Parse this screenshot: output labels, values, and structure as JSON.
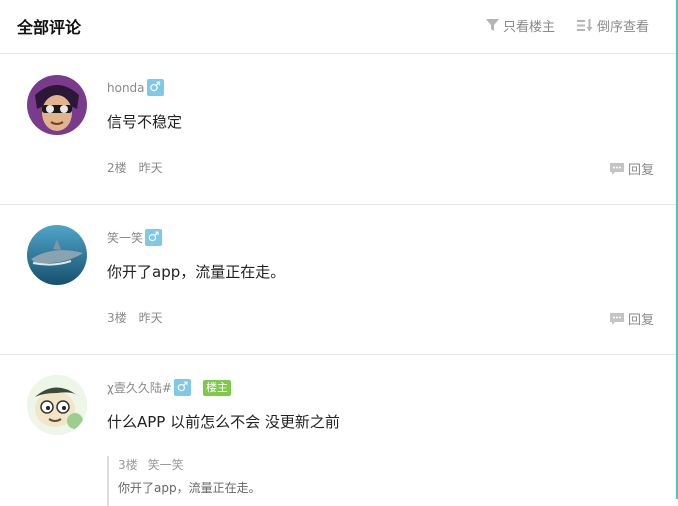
{
  "header": {
    "title": "全部评论",
    "only_op": "只看楼主",
    "reverse": "倒序查看"
  },
  "comments": [
    {
      "username": "honda",
      "gender": "♂",
      "text": "信号不稳定",
      "floor": "2楼",
      "time": "昨天",
      "reply": "回复",
      "avatar": "masked-person-avatar"
    },
    {
      "username": "笑一笑",
      "gender": "♂",
      "text": "你开了app，流量正在走。",
      "floor": "3楼",
      "time": "昨天",
      "reply": "回复",
      "avatar": "shark-avatar"
    },
    {
      "username": "χ壹久久陆#",
      "gender": "♂",
      "badge": "楼主",
      "text": "什么APP 以前怎么不会 没更新之前",
      "avatar": "cartoon-avatar",
      "quote": {
        "floor": "3楼",
        "user": "笑一笑",
        "text": "你开了app，流量正在走。"
      }
    }
  ],
  "colors": {
    "accent_edge": "#4ec3c9",
    "gender_badge": "#7fc8e8",
    "op_badge": "#7ec94a",
    "muted_text": "#8a8a8a"
  }
}
